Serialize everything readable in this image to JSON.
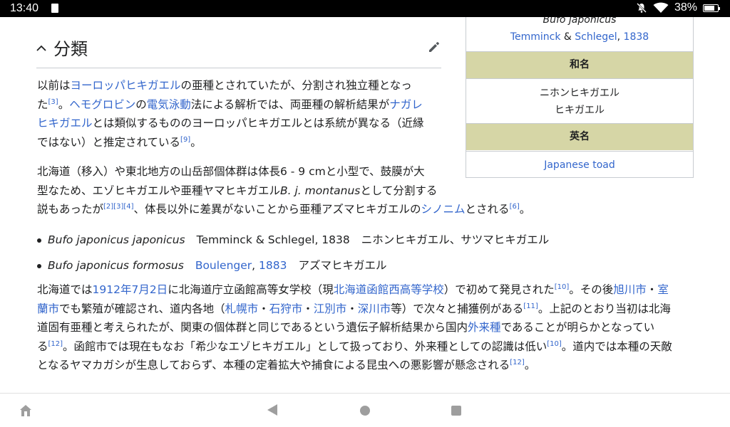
{
  "status_bar": {
    "time": "13:40",
    "battery": "38%",
    "icons": [
      "sd-card-icon",
      "silent-bell-icon",
      "wifi-icon",
      "battery-charging-icon"
    ]
  },
  "section": {
    "title": "分類"
  },
  "para1": {
    "l1a": "以前は",
    "l1link": "ヨーロッパヒキガエル",
    "l1b": "の亜種とされていたが、分割され独立種となっ",
    "l2a": "た",
    "l2sup": "[3]",
    "l2b": "。",
    "l2link1": "ヘモグロビン",
    "l2c": "の",
    "l2link2": "電気泳動",
    "l2d": "法による解析では、両亜種の解析結果が",
    "l2link3": "ナガレ",
    "l3link": "ヒキガエル",
    "l3b": "とは類似するもののヨーロッパヒキガエルとは系統が異なる（近縁",
    "l4a": "ではない）と推定されている",
    "l4sup": "[9]",
    "l4b": "。"
  },
  "para2": {
    "l1": "北海道（移入）や東北地方の山岳部個体群は体長6 - 9 cmと小型で、鼓膜が大",
    "l2a": "型なため、エゾヒキガエルや亜種ヤマヒキガエル",
    "l2it": "B. j. montanus",
    "l2b": "として分割する",
    "l3a": "説もあったが",
    "l3sup": "[2][3][4]",
    "l3b": "、体長以外に差異がないことから亜種アズマヒキガエルの",
    "l3link": "シノニム",
    "l3c": "とされる",
    "l3sup2": "[6]",
    "l3d": "。"
  },
  "subspecies": [
    {
      "name": "Bufo japonicus japonicus",
      "author": "Temminck & Schlegel, 1838",
      "common": "ニホンヒキガエル、サツマヒキガエル"
    },
    {
      "name": "Bufo japonicus formosus",
      "author_link": "Boulenger",
      "sep": ", ",
      "year_link": "1883",
      "common": "アズマヒキガエル"
    }
  ],
  "para3": {
    "l1a": "北海道では",
    "l1link1": "1912年7月2日",
    "l1b": "に北海道庁立函館高等女学校（現",
    "l1link2": "北海道函館西高等学校",
    "l1c": "）で初めて発見された",
    "l1sup": "[10]",
    "l1d": "。その後",
    "l1link3": "旭川市",
    "l1e": "・",
    "l1link4": "室",
    "l2link1": "蘭市",
    "l2a": "でも繁殖が確認され、道内各地（",
    "l2link2": "札幌市",
    "l2b": "・",
    "l2link3": "石狩市",
    "l2c": "・",
    "l2link4": "江別市",
    "l2d": "・",
    "l2link5": "深川市",
    "l2e": "等）で次々と捕獲例がある",
    "l2sup": "[11]",
    "l2f": "。上記のとおり当初は北海",
    "l3a": "道固有亜種と考えられたが、関東の個体群と同じであるという遺伝子解析結果から国内",
    "l3link": "外来種",
    "l3b": "であることが明らかとなってい",
    "l4a": "る",
    "l4sup": "[12]",
    "l4b": "。函館市では現在もなお「希少なエゾヒキガエル」として扱っており、外来種としての認識は低い",
    "l4sup2": "[10]",
    "l4c": "。道内では本種の天敵",
    "l5a": "となるヤマカガシが生息しておらず、本種の定着拡大や捕食による昆虫への悪影響が懸念される",
    "l5sup": "[12]",
    "l5b": "。"
  },
  "infobox": {
    "species": "Bufo japonicus",
    "author1": "Temminck",
    "amp": " & ",
    "author2": "Schlegel",
    "comma": ", ",
    "year": "1838",
    "wamei_header": "和名",
    "wamei1": "ニホンヒキガエル",
    "wamei2": "ヒキガエル",
    "eimei_header": "英名",
    "eimei": "Japanese toad"
  },
  "colors": {
    "link": "#3366cc",
    "infobox_header": "#d6d6a6",
    "text": "#202122"
  }
}
